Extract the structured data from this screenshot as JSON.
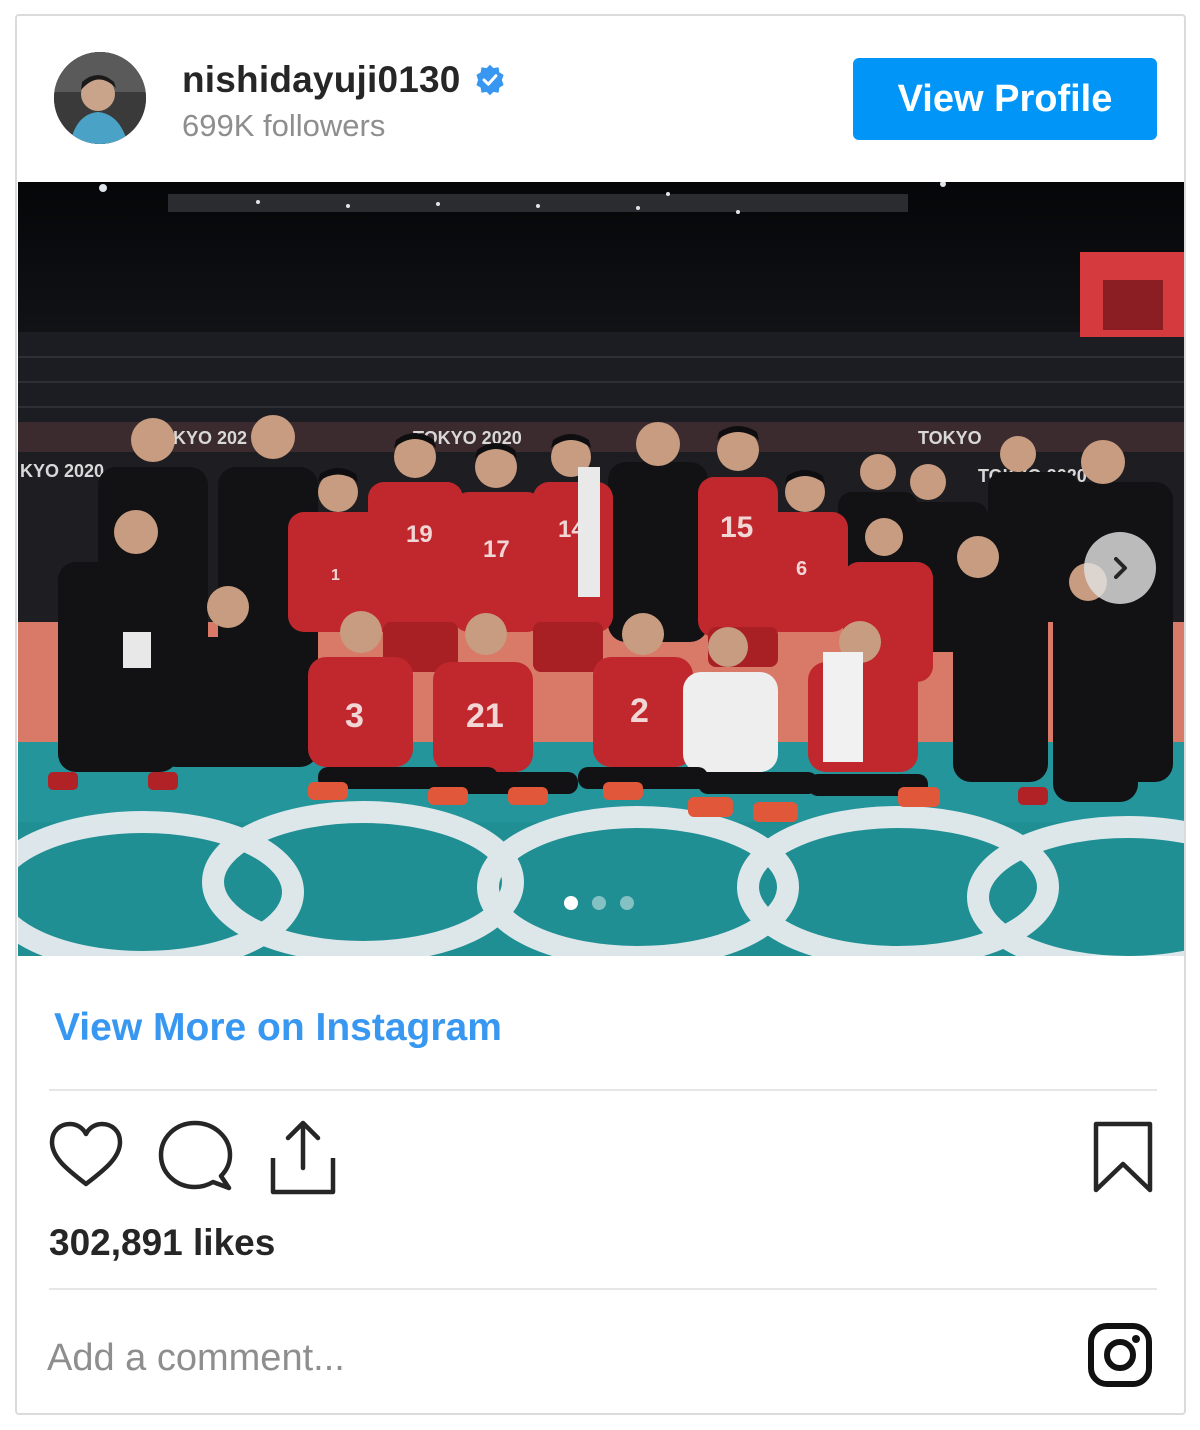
{
  "header": {
    "username": "nishidayuji0130",
    "followers": "699K followers",
    "view_profile_label": "View Profile"
  },
  "post": {
    "photo_banners": [
      "KYO 202",
      "TOKYO 2020",
      "TOKYO",
      "KYO 2020",
      "TOKYO 2020"
    ],
    "jersey_numbers": [
      "19",
      "17",
      "14",
      "15",
      "1",
      "6",
      "3",
      "21",
      "2"
    ],
    "carousel_dots": 3,
    "carousel_active_index": 0
  },
  "view_more_label": "View More on Instagram",
  "actions": {
    "like_icon": "heart-icon",
    "comment_icon": "comment-bubble-icon",
    "share_icon": "share-upload-icon",
    "save_icon": "bookmark-icon"
  },
  "likes_text": "302,891 likes",
  "comment": {
    "placeholder": "Add a comment..."
  },
  "colors": {
    "accent": "#0095f6",
    "link": "#3897f0",
    "verified": "#3897f0",
    "jersey_red": "#c0282d",
    "court_teal": "#1f8f93"
  }
}
